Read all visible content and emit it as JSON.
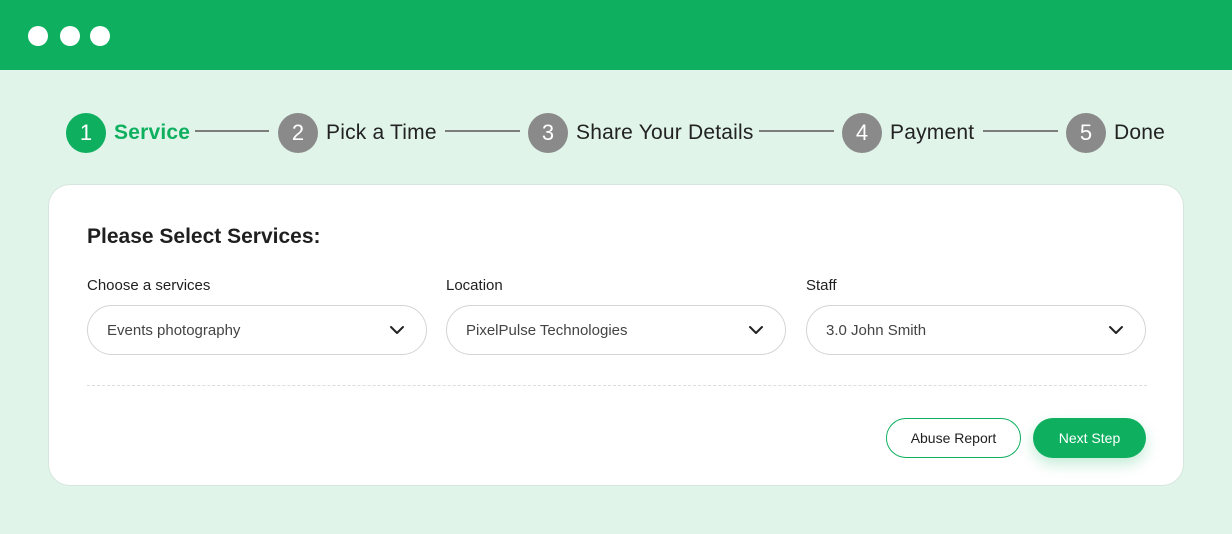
{
  "window": {
    "controls": [
      "dot",
      "dot",
      "dot"
    ]
  },
  "steps": [
    {
      "number": "1",
      "label": "Service",
      "active": true
    },
    {
      "number": "2",
      "label": "Pick a Time",
      "active": false
    },
    {
      "number": "3",
      "label": "Share Your Details",
      "active": false
    },
    {
      "number": "4",
      "label": "Payment",
      "active": false
    },
    {
      "number": "5",
      "label": "Done",
      "active": false
    }
  ],
  "card": {
    "title": "Please Select Services:",
    "fields": [
      {
        "label": "Choose a services",
        "value": "Events photography",
        "icon": "chevron-down-icon"
      },
      {
        "label": "Location",
        "value": "PixelPulse Technologies",
        "icon": "chevron-down-icon"
      },
      {
        "label": "Staff",
        "value": "3.0 John Smith",
        "icon": "chevron-down-icon"
      }
    ],
    "buttons": {
      "abuse_report": "Abuse Report",
      "next_step": "Next Step"
    }
  },
  "colors": {
    "brand": "#0eb060",
    "background": "#e1f4ea",
    "inactive_step": "#8a8a8a"
  }
}
